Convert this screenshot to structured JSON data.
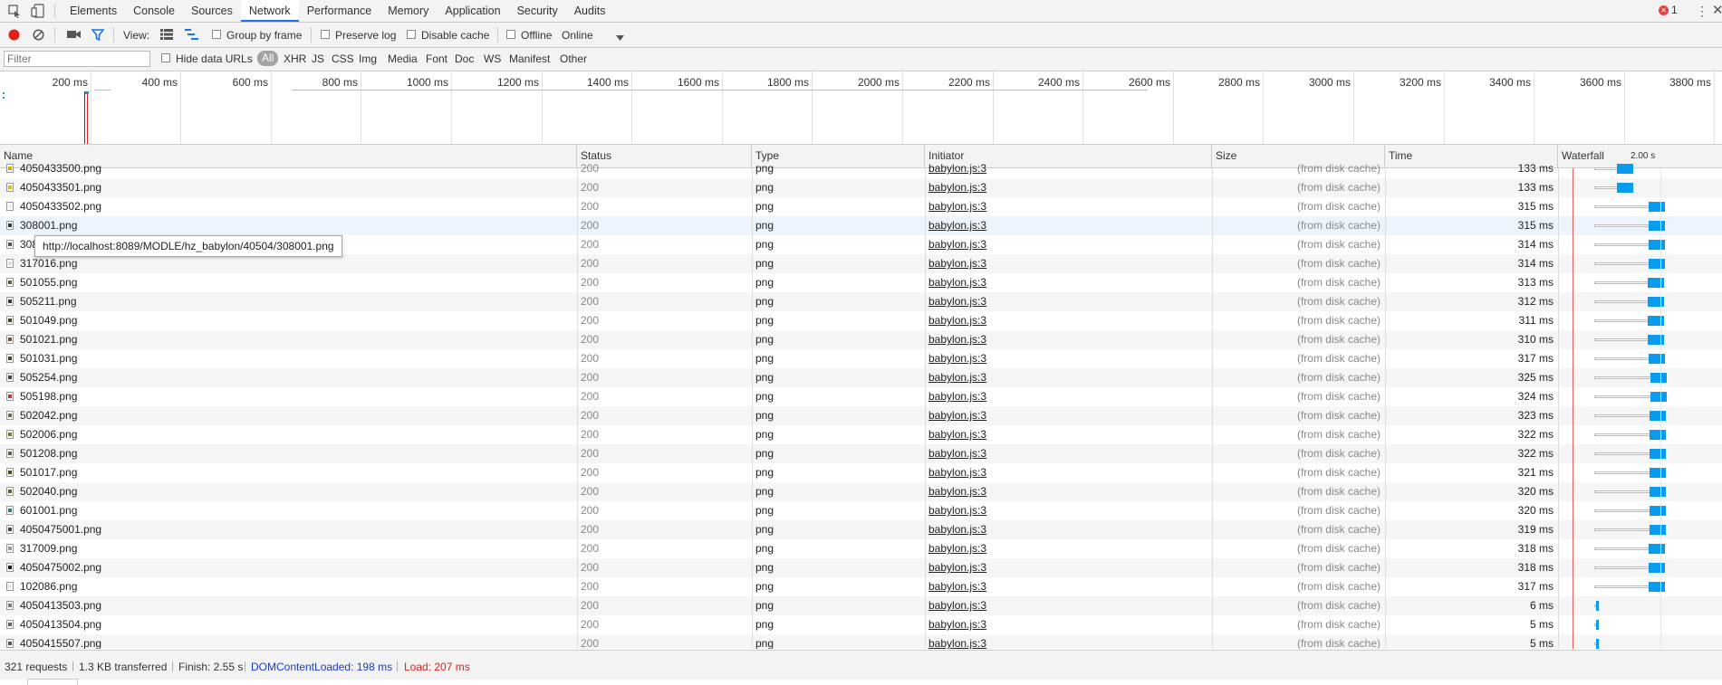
{
  "tabbar": {
    "tabs": [
      "Elements",
      "Console",
      "Sources",
      "Network",
      "Performance",
      "Memory",
      "Application",
      "Security",
      "Audits"
    ],
    "active_tab": "Network",
    "error_count": "1"
  },
  "toolbar": {
    "view_label": "View:",
    "group_by_frame": "Group by frame",
    "preserve_log": "Preserve log",
    "disable_cache": "Disable cache",
    "offline": "Offline",
    "throttling": "Online"
  },
  "filterbar": {
    "placeholder": "Filter",
    "hide_data_urls": "Hide data URLs",
    "types": [
      "All",
      "XHR",
      "JS",
      "CSS",
      "Img",
      "Media",
      "Font",
      "Doc",
      "WS",
      "Manifest",
      "Other"
    ]
  },
  "overview": {
    "ticks": [
      "200 ms",
      "400 ms",
      "600 ms",
      "800 ms",
      "1000 ms",
      "1200 ms",
      "1400 ms",
      "1600 ms",
      "1800 ms",
      "2000 ms",
      "2200 ms",
      "2400 ms",
      "2600 ms",
      "2800 ms",
      "3000 ms",
      "3200 ms",
      "3400 ms",
      "3600 ms",
      "3800 ms"
    ]
  },
  "table": {
    "headers": {
      "name": "Name",
      "status": "Status",
      "type": "Type",
      "initiator": "Initiator",
      "size": "Size",
      "time": "Time",
      "waterfall": "Waterfall",
      "waterfall_scale": "2.00 s"
    },
    "rows": [
      {
        "name": "4050433500.png",
        "status": "200",
        "type": "png",
        "initiator": "babylon.js:3",
        "size": "(from disk cache)",
        "time": "133 ms",
        "icon_color": "#d8a800",
        "partial": true
      },
      {
        "name": "4050433501.png",
        "status": "200",
        "type": "png",
        "initiator": "babylon.js:3",
        "size": "(from disk cache)",
        "time": "133 ms",
        "icon_color": "#e8b800"
      },
      {
        "name": "4050433502.png",
        "status": "200",
        "type": "png",
        "initiator": "babylon.js:3",
        "size": "(from disk cache)",
        "time": "315 ms",
        "icon_color": "#f0f0f0"
      },
      {
        "name": "308001.png",
        "status": "200",
        "type": "png",
        "initiator": "babylon.js:3",
        "size": "(from disk cache)",
        "time": "315 ms",
        "icon_color": "#2a3a4a"
      },
      {
        "name": "308002.png",
        "status": "200",
        "type": "png",
        "initiator": "babylon.js:3",
        "size": "(from disk cache)",
        "time": "314 ms",
        "icon_color": "#555555"
      },
      {
        "name": "317016.png",
        "status": "200",
        "type": "png",
        "initiator": "babylon.js:3",
        "size": "(from disk cache)",
        "time": "314 ms",
        "icon_color": "#dddddd"
      },
      {
        "name": "501055.png",
        "status": "200",
        "type": "png",
        "initiator": "babylon.js:3",
        "size": "(from disk cache)",
        "time": "313 ms",
        "icon_color": "#556b2f"
      },
      {
        "name": "505211.png",
        "status": "200",
        "type": "png",
        "initiator": "babylon.js:3",
        "size": "(from disk cache)",
        "time": "312 ms",
        "icon_color": "#333333"
      },
      {
        "name": "501049.png",
        "status": "200",
        "type": "png",
        "initiator": "babylon.js:3",
        "size": "(from disk cache)",
        "time": "311 ms",
        "icon_color": "#3a4a20"
      },
      {
        "name": "501021.png",
        "status": "200",
        "type": "png",
        "initiator": "babylon.js:3",
        "size": "(from disk cache)",
        "time": "310 ms",
        "icon_color": "#6b5a20"
      },
      {
        "name": "501031.png",
        "status": "200",
        "type": "png",
        "initiator": "babylon.js:3",
        "size": "(from disk cache)",
        "time": "317 ms",
        "icon_color": "#4a4a20"
      },
      {
        "name": "505254.png",
        "status": "200",
        "type": "png",
        "initiator": "babylon.js:3",
        "size": "(from disk cache)",
        "time": "325 ms",
        "icon_color": "#444444"
      },
      {
        "name": "505198.png",
        "status": "200",
        "type": "png",
        "initiator": "babylon.js:3",
        "size": "(from disk cache)",
        "time": "324 ms",
        "icon_color": "#c0392b"
      },
      {
        "name": "502042.png",
        "status": "200",
        "type": "png",
        "initiator": "babylon.js:3",
        "size": "(from disk cache)",
        "time": "323 ms",
        "icon_color": "#7a6a40"
      },
      {
        "name": "502006.png",
        "status": "200",
        "type": "png",
        "initiator": "babylon.js:3",
        "size": "(from disk cache)",
        "time": "322 ms",
        "icon_color": "#8a7a20"
      },
      {
        "name": "501208.png",
        "status": "200",
        "type": "png",
        "initiator": "babylon.js:3",
        "size": "(from disk cache)",
        "time": "322 ms",
        "icon_color": "#556644"
      },
      {
        "name": "501017.png",
        "status": "200",
        "type": "png",
        "initiator": "babylon.js:3",
        "size": "(from disk cache)",
        "time": "321 ms",
        "icon_color": "#3a5a10"
      },
      {
        "name": "502040.png",
        "status": "200",
        "type": "png",
        "initiator": "babylon.js:3",
        "size": "(from disk cache)",
        "time": "320 ms",
        "icon_color": "#6a5a30"
      },
      {
        "name": "601001.png",
        "status": "200",
        "type": "png",
        "initiator": "babylon.js:3",
        "size": "(from disk cache)",
        "time": "320 ms",
        "icon_color": "#2a7a9a"
      },
      {
        "name": "4050475001.png",
        "status": "200",
        "type": "png",
        "initiator": "babylon.js:3",
        "size": "(from disk cache)",
        "time": "319 ms",
        "icon_color": "#3a4a5a"
      },
      {
        "name": "317009.png",
        "status": "200",
        "type": "png",
        "initiator": "babylon.js:3",
        "size": "(from disk cache)",
        "time": "318 ms",
        "icon_color": "#999999"
      },
      {
        "name": "4050475002.png",
        "status": "200",
        "type": "png",
        "initiator": "babylon.js:3",
        "size": "(from disk cache)",
        "time": "318 ms",
        "icon_color": "#1a1a1a"
      },
      {
        "name": "102086.png",
        "status": "200",
        "type": "png",
        "initiator": "babylon.js:3",
        "size": "(from disk cache)",
        "time": "317 ms",
        "icon_color": "#e8e8e8"
      },
      {
        "name": "4050413503.png",
        "status": "200",
        "type": "png",
        "initiator": "babylon.js:3",
        "size": "(from disk cache)",
        "time": "6 ms",
        "icon_color": "#777777"
      },
      {
        "name": "4050413504.png",
        "status": "200",
        "type": "png",
        "initiator": "babylon.js:3",
        "size": "(from disk cache)",
        "time": "5 ms",
        "icon_color": "#666666"
      },
      {
        "name": "4050415507.png",
        "status": "200",
        "type": "png",
        "initiator": "babylon.js:3",
        "size": "(from disk cache)",
        "time": "5 ms",
        "icon_color": "#555555"
      }
    ],
    "tooltip": "http://localhost:8089/MODLE/hz_babylon/40504/308001.png"
  },
  "statusbar": {
    "requests": "321 requests",
    "transferred": "1.3 KB transferred",
    "finish": "Finish: 2.55 s",
    "dom_content_loaded": "DOMContentLoaded: 198 ms",
    "load": "Load: 207 ms"
  },
  "colors": {
    "accent": "#1a73e8",
    "record": "#e0201b",
    "waterfall_receive": "#0a9bef",
    "dcl_blue": "#1a3bd0",
    "load_red": "#e0201b"
  }
}
